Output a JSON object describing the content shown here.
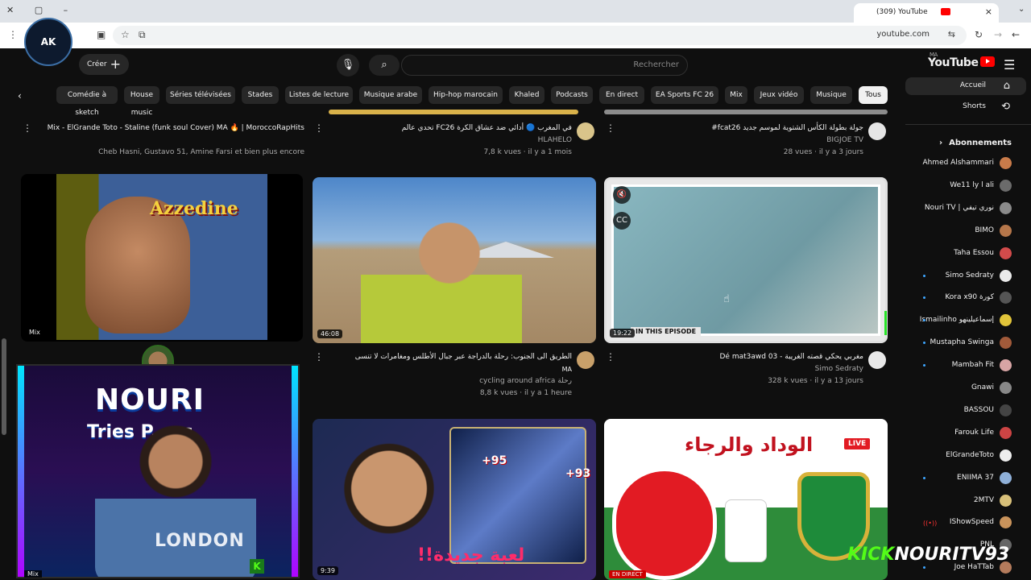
{
  "browser": {
    "tab_title": "(309) YouTube",
    "tab_close": "×",
    "new_tab": "+",
    "url": "youtube.com",
    "window_min": "–",
    "window_max": "▢",
    "window_close": "✕"
  },
  "masthead": {
    "logo_text": "YouTube",
    "logo_region": "MA",
    "search_placeholder": "Rechercher",
    "create_label": "Créer"
  },
  "chips": [
    "Tous",
    "Musique",
    "Jeux vidéo",
    "Mix",
    "EA Sports FC 26",
    "En direct",
    "Podcasts",
    "Khaled",
    "Hip-hop marocain",
    "Musique arabe",
    "Listes de lecture",
    "Stades",
    "Séries télévisées",
    "House music",
    "Comédie à sketch"
  ],
  "sidebar": {
    "nav": [
      {
        "label": "Accueil",
        "icon": "home-icon"
      },
      {
        "label": "Shorts",
        "icon": "shorts-icon"
      }
    ],
    "subs_heading": "Abonnements",
    "subs": [
      {
        "label": "Ahmed Alshammari",
        "dot": false,
        "color": "#c97b4a"
      },
      {
        "label": "We11 ly l ali",
        "dot": false,
        "color": "#6b6b6b"
      },
      {
        "label": "Nouri TV | نوري تيفي",
        "dot": false,
        "color": "#8a8a8a"
      },
      {
        "label": "BIMO",
        "dot": false,
        "color": "#b5764a"
      },
      {
        "label": "Taha Essou",
        "dot": false,
        "color": "#d24b4b"
      },
      {
        "label": "Simo Sedraty",
        "dot": true,
        "color": "#eaeaea"
      },
      {
        "label": "Kora x90 كورة",
        "dot": true,
        "color": "#555"
      },
      {
        "label": "Ismailinho إسماعيلينهو",
        "dot": true,
        "color": "#e1c43a"
      },
      {
        "label": "Mustapha Swinga",
        "dot": true,
        "color": "#a15a3a"
      },
      {
        "label": "Mambah Fit",
        "dot": true,
        "color": "#d8a5a5"
      },
      {
        "label": "Gnawi",
        "dot": false,
        "color": "#888"
      },
      {
        "label": "BASSOU",
        "dot": false,
        "color": "#444"
      },
      {
        "label": "Farouk Life",
        "dot": false,
        "color": "#c44"
      },
      {
        "label": "ElGrandeToto",
        "dot": false,
        "color": "#eee"
      },
      {
        "label": "ENIIMA 37",
        "dot": true,
        "color": "#8fb0d8"
      },
      {
        "label": "2MTV",
        "dot": false,
        "color": "#d8c07a"
      },
      {
        "label": "IShowSpeed",
        "dot": false,
        "live": true,
        "color": "#c9935b"
      },
      {
        "label": "PNL",
        "dot": false,
        "color": "#666"
      },
      {
        "label": "Joe HaTTab",
        "dot": true,
        "color": "#b47b5c"
      }
    ]
  },
  "videos_top": [
    {
      "title": "#fcat26 جولة بطولة الكأس الشتوية لموسم جديد",
      "meta1": "BIGJOE TV",
      "meta2": "28 vues · il y a 3 jours"
    },
    {
      "title": "تحدي عالم FC26 في المغرب 🔵 أدائي ضد عشاق الكرة",
      "meta1": "HLAHELO",
      "meta2": "7,8 k vues · il y a 1 mois"
    },
    {
      "title": "Mix - ElGrande Toto - Staline (funk soul Cover) MA 🔥 | MoroccoRapHits",
      "meta1": "Cheb Hasni, Gustavo 51, Amine Farsi et bien plus encore",
      "meta2": ""
    }
  ],
  "videos_mid": [
    {
      "title": "Dé mat3awd 03 - مغربي يحكي قصته الغريبة",
      "channel": "Simo Sedraty",
      "meta": "328 k vues · il y a 13 jours",
      "duration": "19:22",
      "badge": "IN THIS EPISODE"
    },
    {
      "title": "الطريق الى الجنوب: رحلة بالدراجة عبر جبال الأطلس ومغامرات لا تنسى",
      "channel": "cycling around africa رحلة",
      "meta": "8,8 k vues · il y a 1 heure",
      "duration": "46:08",
      "badge_ma": "MA"
    },
    {
      "title": "Azzedine",
      "channel": "",
      "meta": "",
      "duration": "Mix",
      "poster_name": "Azzedine"
    }
  ],
  "videos_bottom": [
    {
      "title": "الوداد والرجاء",
      "live": "LIVE",
      "direct": "EN DIRECT"
    },
    {
      "title": "!!لعبة جديدة",
      "duration": "9:39",
      "plus1": "+95",
      "plus2": "+93"
    }
  ],
  "webcam": {
    "heading": "NOURI",
    "sub": "Tries P...es",
    "shirt": "LONDON",
    "kick_badge": "K",
    "mix_label": "Mix"
  },
  "watermark": {
    "kick": "KICK",
    "name": "NOURITV93"
  },
  "avatar_text": "AK"
}
